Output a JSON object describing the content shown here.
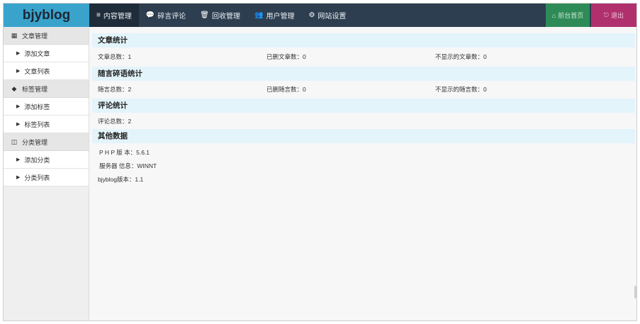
{
  "brand": "bjyblog",
  "nav": [
    {
      "icon": "≡",
      "label": "内容管理"
    },
    {
      "icon": "💬",
      "label": "碎言评论"
    },
    {
      "icon": "🗑",
      "label": "回收管理"
    },
    {
      "icon": "👥",
      "label": "用户管理"
    },
    {
      "icon": "⚙",
      "label": "网站设置"
    }
  ],
  "actions": {
    "home": {
      "icon": "⌂",
      "label": "前台首页"
    },
    "logout": {
      "icon": "⎋",
      "label": "退出"
    }
  },
  "sidebar": [
    {
      "type": "group",
      "icon": "▦",
      "label": "文章管理"
    },
    {
      "type": "item",
      "label": "添加文章"
    },
    {
      "type": "item",
      "label": "文章列表"
    },
    {
      "type": "group",
      "icon": "◆",
      "label": "标签管理"
    },
    {
      "type": "item",
      "label": "添加标签"
    },
    {
      "type": "item",
      "label": "标签列表"
    },
    {
      "type": "group",
      "icon": "◫",
      "label": "分类管理"
    },
    {
      "type": "item",
      "label": "添加分类"
    },
    {
      "type": "item",
      "label": "分类列表"
    }
  ],
  "sections": {
    "articles": {
      "title": "文章统计",
      "total": "文章总数：1",
      "deleted": "已删文章数：0",
      "hidden": "不显示的文章数：0"
    },
    "chats": {
      "title": "随言碎语统计",
      "total": "随言总数：2",
      "deleted": "已删随言数：0",
      "hidden": "不显示的随言数：0"
    },
    "comments": {
      "title": "评论统计",
      "total": "评论总数：2"
    },
    "other": {
      "title": "其他数据",
      "php": "P H P 版 本：5.6.1",
      "server": "服务器 信息：WINNT",
      "version": "bjyblog版本：1.1"
    }
  }
}
